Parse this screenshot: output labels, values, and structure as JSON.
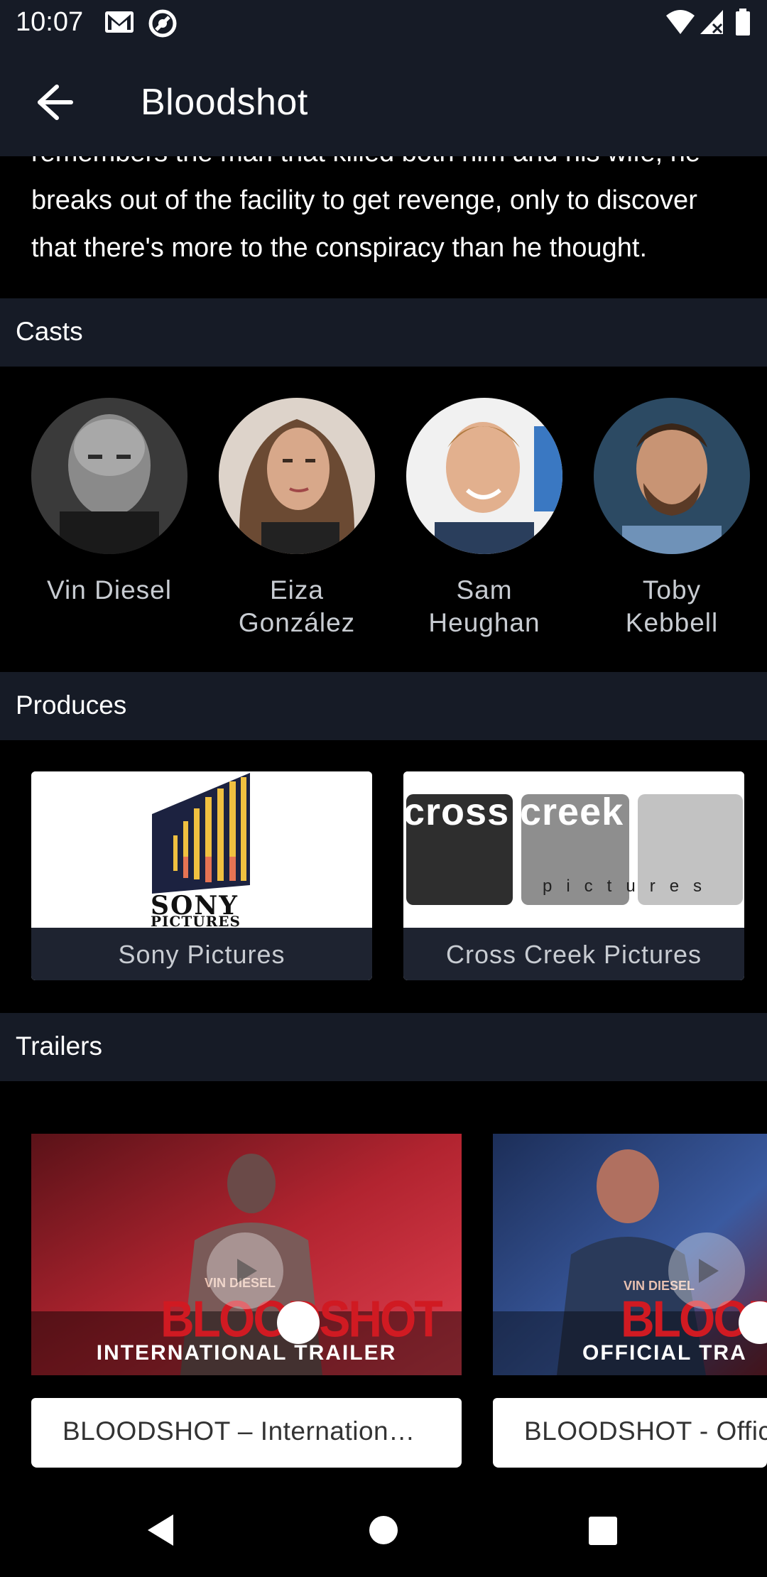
{
  "status_bar": {
    "time": "10:07"
  },
  "app_bar": {
    "title": "Bloodshot"
  },
  "overview": {
    "text": "remembers the man that killed both him and his wife, he breaks out of the facility to get revenge, only to discover that there's more to the conspiracy than he thought."
  },
  "sections": {
    "casts": "Casts",
    "produces": "Produces",
    "trailers": "Trailers"
  },
  "casts": [
    {
      "name": "Vin Diesel"
    },
    {
      "name": "Eiza González"
    },
    {
      "name": "Sam Heughan"
    },
    {
      "name": "Toby Kebbell"
    }
  ],
  "companies": [
    {
      "name": "Sony Pictures",
      "logo_text": "SONY",
      "logo_sub": "PICTURES"
    },
    {
      "name": "Cross Creek Pictures",
      "logo_words": [
        "cross",
        "creek",
        "pictures"
      ]
    }
  ],
  "trailers": [
    {
      "title": "BLOODSHOT – Internation…",
      "banner": "INTERNATIONAL TRAILER",
      "brand": "BLOODSHOT",
      "star": "VIN DIESEL"
    },
    {
      "title": "BLOODSHOT - Offic",
      "banner": "OFFICIAL TRA",
      "brand": "BLOODSH",
      "star": "VIN DIESEL"
    }
  ],
  "colors": {
    "bar_background": "#161b26",
    "page_background": "#000000",
    "cast_name": "#c8ccd2",
    "trailer_red": "#c4181e"
  }
}
